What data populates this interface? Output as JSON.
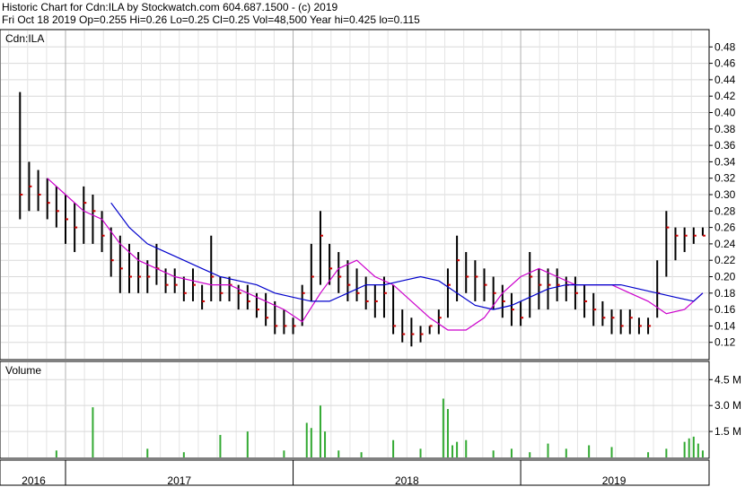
{
  "header": {
    "line1": "Historic Chart for Cdn:ILA by Stockwatch.com 604.687.1500 - (c) 2019",
    "line2": "Fri Oct 18 2019  Op=0.255  Hi=0.26  Lo=0.25  Cl=0.25  Vol=48,500  Year hi=0.425  lo=0.115"
  },
  "chart_data": [
    {
      "type": "line",
      "title": "Cdn:ILA",
      "ylim": [
        0.1,
        0.5
      ],
      "y_ticks": [
        "0.12",
        "0.14",
        "0.16",
        "0.18",
        "0.20",
        "0.22",
        "0.24",
        "0.26",
        "0.28",
        "0.30",
        "0.32",
        "0.34",
        "0.36",
        "0.38",
        "0.40",
        "0.42",
        "0.44",
        "0.46",
        "0.48"
      ],
      "x_labels": [
        "2016",
        "2017",
        "2018",
        "2019"
      ],
      "grid": true,
      "series": [
        {
          "style": "daily-bars",
          "color": "#000000",
          "x": [
            2016.8,
            2016.84,
            2016.88,
            2016.92,
            2016.96,
            2017.0,
            2017.04,
            2017.08,
            2017.12,
            2017.16,
            2017.2,
            2017.24,
            2017.28,
            2017.32,
            2017.36,
            2017.4,
            2017.44,
            2017.48,
            2017.52,
            2017.56,
            2017.6,
            2017.64,
            2017.68,
            2017.72,
            2017.76,
            2017.8,
            2017.84,
            2017.88,
            2017.92,
            2017.96,
            2018.0,
            2018.04,
            2018.08,
            2018.12,
            2018.16,
            2018.2,
            2018.24,
            2018.28,
            2018.32,
            2018.36,
            2018.4,
            2018.44,
            2018.48,
            2018.52,
            2018.56,
            2018.6,
            2018.64,
            2018.68,
            2018.72,
            2018.76,
            2018.8,
            2018.84,
            2018.88,
            2018.92,
            2018.96,
            2019.0,
            2019.04,
            2019.08,
            2019.12,
            2019.16,
            2019.2,
            2019.24,
            2019.28,
            2019.32,
            2019.36,
            2019.4,
            2019.44,
            2019.48,
            2019.52,
            2019.56,
            2019.6,
            2019.64,
            2019.68,
            2019.72,
            2019.76,
            2019.8
          ],
          "high": [
            0.425,
            0.34,
            0.33,
            0.32,
            0.31,
            0.3,
            0.29,
            0.31,
            0.3,
            0.28,
            0.26,
            0.25,
            0.24,
            0.23,
            0.22,
            0.24,
            0.21,
            0.21,
            0.2,
            0.21,
            0.19,
            0.25,
            0.2,
            0.2,
            0.19,
            0.19,
            0.18,
            0.18,
            0.17,
            0.16,
            0.15,
            0.19,
            0.24,
            0.28,
            0.24,
            0.23,
            0.22,
            0.21,
            0.2,
            0.19,
            0.2,
            0.19,
            0.16,
            0.15,
            0.14,
            0.14,
            0.16,
            0.21,
            0.25,
            0.23,
            0.22,
            0.21,
            0.2,
            0.19,
            0.18,
            0.17,
            0.23,
            0.21,
            0.21,
            0.21,
            0.2,
            0.2,
            0.19,
            0.18,
            0.17,
            0.16,
            0.16,
            0.16,
            0.15,
            0.15,
            0.22,
            0.28,
            0.26,
            0.26,
            0.26,
            0.26
          ],
          "low": [
            0.27,
            0.28,
            0.28,
            0.27,
            0.26,
            0.24,
            0.23,
            0.24,
            0.24,
            0.23,
            0.2,
            0.18,
            0.18,
            0.18,
            0.18,
            0.19,
            0.18,
            0.18,
            0.17,
            0.17,
            0.16,
            0.17,
            0.17,
            0.17,
            0.16,
            0.16,
            0.15,
            0.14,
            0.13,
            0.13,
            0.13,
            0.14,
            0.17,
            0.19,
            0.19,
            0.18,
            0.17,
            0.17,
            0.16,
            0.15,
            0.15,
            0.13,
            0.12,
            0.115,
            0.12,
            0.13,
            0.13,
            0.15,
            0.17,
            0.18,
            0.17,
            0.17,
            0.16,
            0.15,
            0.14,
            0.14,
            0.15,
            0.16,
            0.16,
            0.17,
            0.17,
            0.16,
            0.15,
            0.14,
            0.14,
            0.13,
            0.13,
            0.13,
            0.13,
            0.13,
            0.15,
            0.2,
            0.22,
            0.23,
            0.24,
            0.25
          ],
          "close": [
            0.3,
            0.31,
            0.3,
            0.29,
            0.28,
            0.27,
            0.26,
            0.29,
            0.28,
            0.25,
            0.22,
            0.21,
            0.2,
            0.2,
            0.2,
            0.21,
            0.19,
            0.19,
            0.18,
            0.19,
            0.17,
            0.2,
            0.18,
            0.19,
            0.18,
            0.17,
            0.16,
            0.15,
            0.14,
            0.14,
            0.14,
            0.18,
            0.2,
            0.25,
            0.21,
            0.2,
            0.19,
            0.18,
            0.17,
            0.17,
            0.18,
            0.14,
            0.13,
            0.13,
            0.13,
            0.14,
            0.15,
            0.19,
            0.22,
            0.2,
            0.2,
            0.19,
            0.18,
            0.17,
            0.16,
            0.15,
            0.2,
            0.19,
            0.19,
            0.19,
            0.19,
            0.18,
            0.17,
            0.16,
            0.15,
            0.15,
            0.14,
            0.15,
            0.14,
            0.14,
            0.18,
            0.26,
            0.25,
            0.25,
            0.25,
            0.25
          ]
        },
        {
          "style": "moving-average",
          "color": "#cc00cc",
          "x": [
            2016.92,
            2017.0,
            2017.08,
            2017.16,
            2017.24,
            2017.32,
            2017.4,
            2017.48,
            2017.56,
            2017.64,
            2017.72,
            2017.8,
            2017.88,
            2017.96,
            2018.04,
            2018.12,
            2018.2,
            2018.28,
            2018.36,
            2018.44,
            2018.52,
            2018.6,
            2018.68,
            2018.76,
            2018.84,
            2018.92,
            2019.0,
            2019.08,
            2019.16,
            2019.24,
            2019.32,
            2019.4,
            2019.48,
            2019.56,
            2019.64,
            2019.72,
            2019.8
          ],
          "values": [
            0.32,
            0.3,
            0.28,
            0.27,
            0.24,
            0.22,
            0.21,
            0.2,
            0.195,
            0.19,
            0.19,
            0.18,
            0.17,
            0.16,
            0.145,
            0.18,
            0.21,
            0.22,
            0.2,
            0.19,
            0.17,
            0.15,
            0.135,
            0.135,
            0.15,
            0.18,
            0.2,
            0.21,
            0.2,
            0.19,
            0.19,
            0.19,
            0.18,
            0.17,
            0.155,
            0.16,
            0.18
          ]
        },
        {
          "style": "moving-average",
          "color": "#0000cc",
          "x": [
            2017.2,
            2017.28,
            2017.36,
            2017.44,
            2017.52,
            2017.6,
            2017.68,
            2017.76,
            2017.84,
            2017.92,
            2018.0,
            2018.08,
            2018.16,
            2018.24,
            2018.32,
            2018.4,
            2018.48,
            2018.56,
            2018.64,
            2018.72,
            2018.8,
            2018.88,
            2018.96,
            2019.04,
            2019.12,
            2019.2,
            2019.28,
            2019.36,
            2019.44,
            2019.52,
            2019.6,
            2019.68,
            2019.76,
            2019.8
          ],
          "values": [
            0.29,
            0.26,
            0.24,
            0.23,
            0.22,
            0.21,
            0.2,
            0.195,
            0.19,
            0.18,
            0.175,
            0.17,
            0.17,
            0.18,
            0.19,
            0.19,
            0.195,
            0.2,
            0.195,
            0.18,
            0.165,
            0.16,
            0.165,
            0.175,
            0.185,
            0.19,
            0.19,
            0.19,
            0.19,
            0.185,
            0.18,
            0.175,
            0.17,
            0.18
          ]
        }
      ]
    },
    {
      "type": "bar",
      "title": "Volume",
      "ylim": [
        0,
        5500000
      ],
      "y_ticks": [
        "1.5 M",
        "3.0 M",
        "4.5 M"
      ],
      "x_labels": [
        "2016",
        "2017",
        "2018",
        "2019"
      ],
      "grid": true,
      "x": [
        2016.96,
        2017.12,
        2017.36,
        2017.52,
        2017.68,
        2017.8,
        2017.96,
        2018.06,
        2018.08,
        2018.12,
        2018.14,
        2018.2,
        2018.3,
        2018.44,
        2018.56,
        2018.66,
        2018.68,
        2018.7,
        2018.72,
        2018.76,
        2018.88,
        2018.96,
        2019.04,
        2019.12,
        2019.2,
        2019.3,
        2019.4,
        2019.56,
        2019.64,
        2019.72,
        2019.74,
        2019.76,
        2019.78,
        2019.8
      ],
      "values": [
        400000,
        2900000,
        500000,
        300000,
        1300000,
        1500000,
        400000,
        2000000,
        1700000,
        3000000,
        1500000,
        400000,
        300000,
        1000000,
        500000,
        3400000,
        2800000,
        700000,
        900000,
        1000000,
        400000,
        500000,
        300000,
        800000,
        500000,
        700000,
        600000,
        300000,
        500000,
        900000,
        1100000,
        1200000,
        800000,
        400000
      ]
    }
  ]
}
